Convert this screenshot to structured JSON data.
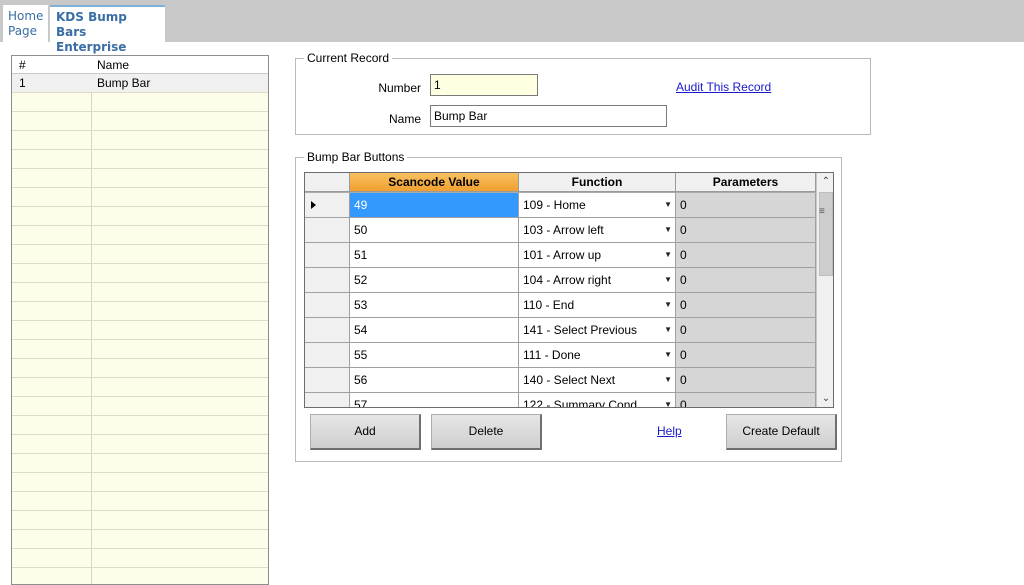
{
  "tabs": {
    "home_line1": "Home",
    "home_line2": "Page",
    "active_line1": "KDS Bump Bars",
    "active_line2": "Enterprise"
  },
  "left_list": {
    "columns": [
      "#",
      "Name"
    ],
    "rows": [
      {
        "num": "1",
        "name": "Bump Bar"
      }
    ]
  },
  "current_record": {
    "legend": "Current Record",
    "number_label": "Number",
    "number_value": "1",
    "name_label": "Name",
    "name_value": "Bump Bar",
    "audit_link": "Audit This Record"
  },
  "bump_bar_buttons": {
    "legend": "Bump Bar Buttons",
    "columns": [
      "Scancode Value",
      "Function",
      "Parameters"
    ],
    "rows": [
      {
        "scancode": "49",
        "function": "109 - Home",
        "params": "0"
      },
      {
        "scancode": "50",
        "function": "103 - Arrow left",
        "params": "0"
      },
      {
        "scancode": "51",
        "function": "101 - Arrow up",
        "params": "0"
      },
      {
        "scancode": "52",
        "function": "104 - Arrow right",
        "params": "0"
      },
      {
        "scancode": "53",
        "function": "110 - End",
        "params": "0"
      },
      {
        "scancode": "54",
        "function": "141 - Select Previous",
        "params": "0"
      },
      {
        "scancode": "55",
        "function": "111 - Done",
        "params": "0"
      },
      {
        "scancode": "56",
        "function": "140 - Select Next",
        "params": "0"
      },
      {
        "scancode": "57",
        "function": "122 - Summary Cond...",
        "params": "0"
      }
    ],
    "add_label": "Add",
    "delete_label": "Delete",
    "help_link": "Help",
    "create_default_label": "Create Default"
  }
}
